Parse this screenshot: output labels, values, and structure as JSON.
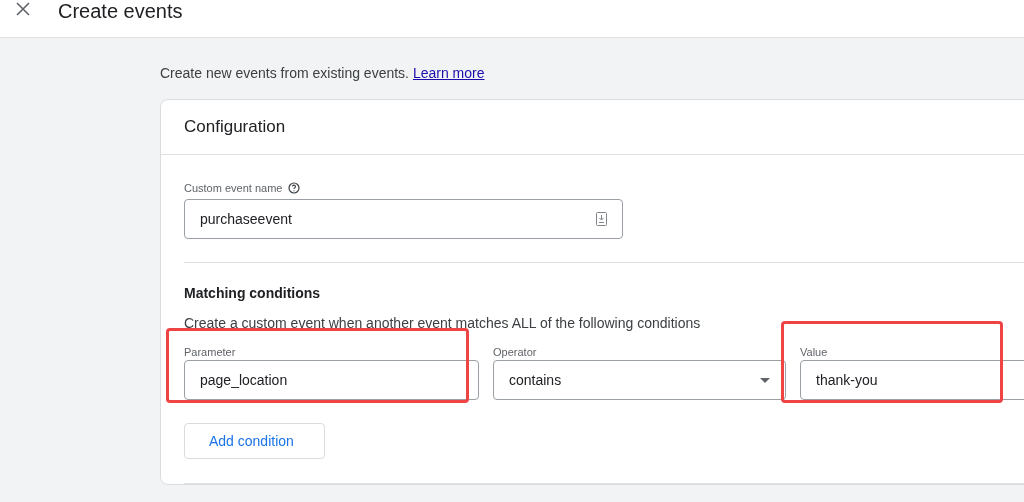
{
  "header": {
    "title": "Create events"
  },
  "intro": {
    "text": "Create new events from existing events.",
    "link": "Learn more"
  },
  "configuration": {
    "title": "Configuration",
    "custom_event_name": {
      "label": "Custom event name",
      "value": "purchaseevent"
    },
    "matching": {
      "title": "Matching conditions",
      "description": "Create a custom event when another event matches ALL of the following conditions",
      "conditions": [
        {
          "kind": "text",
          "label": "Parameter",
          "value": "page_location",
          "highlighted": true
        },
        {
          "kind": "dropdown",
          "label": "Operator",
          "value": "contains",
          "highlighted": false
        },
        {
          "kind": "text",
          "label": "Value",
          "value": "thank-you",
          "highlighted": true
        }
      ],
      "add_button": "Add condition"
    }
  }
}
